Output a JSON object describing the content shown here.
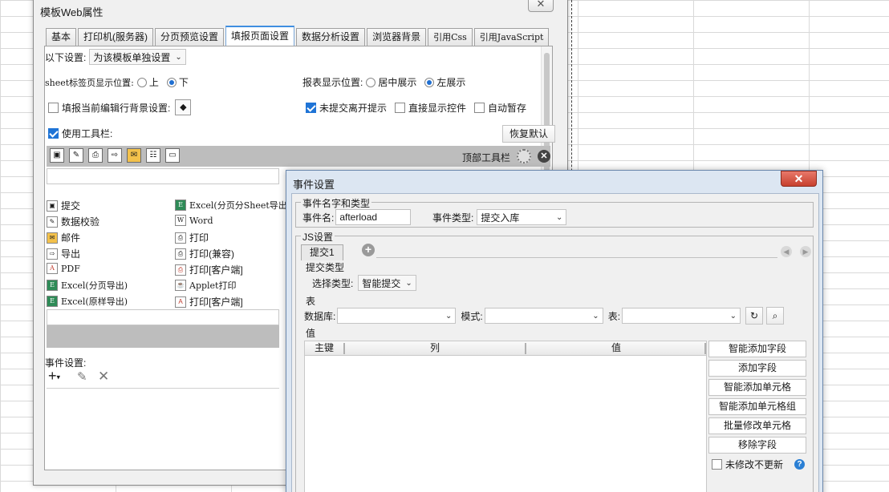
{
  "main_dialog": {
    "title": "模板Web属性",
    "close_glyph": "✕",
    "tabs": [
      "基本",
      "打印机(服务器)",
      "分页预览设置",
      "填报页面设置",
      "数据分析设置",
      "浏览器背景",
      "引用Css",
      "引用JavaScript"
    ],
    "active_tab": "填报页面设置",
    "settings_label": "以下设置:",
    "settings_value": "为该模板单独设置",
    "sheet_pos_label": "sheet标签页显示位置:",
    "sheet_pos_options": [
      "上",
      "下"
    ],
    "sheet_pos_selected": "下",
    "report_pos_label": "报表显示位置:",
    "report_pos_options": [
      "居中展示",
      "左展示"
    ],
    "report_pos_selected": "左展示",
    "row_bg_label": "填报当前编辑行背景设置:",
    "row_bg_checked": false,
    "unsubmitted_prompt_label": "未提交离开提示",
    "unsubmitted_prompt_checked": true,
    "direct_show_label": "直接显示控件",
    "direct_show_checked": false,
    "autosave_label": "自动暂存",
    "autosave_checked": false,
    "use_toolbar_label": "使用工具栏:",
    "use_toolbar_checked": true,
    "restore_default": "恢复默认",
    "top_toolbar_label": "顶部工具栏",
    "toolbar_items_left": [
      "提交",
      "数据校验",
      "邮件",
      "导出",
      "PDF",
      "Excel(分页导出)",
      "Excel(原样导出)"
    ],
    "toolbar_items_right": [
      "Excel(分页分Sheet导出",
      "Word",
      "打印",
      "打印(兼容)",
      "打印[客户端]",
      "Applet打印",
      "打印[客户端]"
    ],
    "event_settings_label": "事件设置:"
  },
  "event_dialog": {
    "title": "事件设置",
    "close_glyph": "✕",
    "group_name_type": "事件名字和类型",
    "event_name_label": "事件名:",
    "event_name_value": "afterload",
    "event_type_label": "事件类型:",
    "event_type_value": "提交入库",
    "js_group": "JS设置",
    "subtab": "提交1",
    "submit_type_group": "提交类型",
    "select_type_label": "选择类型:",
    "select_type_value": "智能提交",
    "table_group": "表",
    "db_label": "数据库:",
    "mode_label": "模式:",
    "table_label": "表:",
    "value_group": "值",
    "columns": [
      "主键",
      "列",
      "值"
    ],
    "buttons": [
      "智能添加字段",
      "添加字段",
      "智能添加单元格",
      "智能添加单元格组",
      "批量修改单元格",
      "移除字段"
    ],
    "no_update_label": "未修改不更新",
    "no_update_checked": false,
    "help_glyph": "?"
  }
}
